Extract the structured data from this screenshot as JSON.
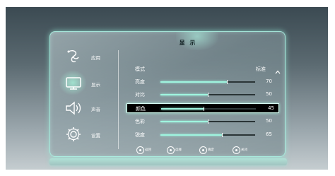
{
  "panel": {
    "title": "显 示"
  },
  "sidebar": {
    "items": [
      {
        "label": "应用",
        "icon": "app-swirl-icon",
        "active": false
      },
      {
        "label": "显示",
        "icon": "monitor-icon",
        "active": true
      },
      {
        "label": "声音",
        "icon": "speaker-icon",
        "active": false
      },
      {
        "label": "设置",
        "icon": "gear-icon",
        "active": false
      }
    ]
  },
  "mode": {
    "label": "模式",
    "value": "标准",
    "icon": "chevron-up-icon"
  },
  "settings": [
    {
      "label": "亮度",
      "value": "70",
      "level": 0.7,
      "selected": false
    },
    {
      "label": "对比",
      "value": "50",
      "level": 0.5,
      "selected": false
    },
    {
      "label": "颜色",
      "value": "45",
      "level": 0.45,
      "selected": true
    },
    {
      "label": "色彩",
      "value": "50",
      "level": 0.5,
      "selected": false
    },
    {
      "label": "锐度",
      "value": "65",
      "level": 0.65,
      "selected": false
    }
  ],
  "footer": [
    {
      "label": "返回",
      "icon": "back-ring-icon"
    },
    {
      "label": "选择",
      "icon": "select-ring-icon"
    },
    {
      "label": "确定",
      "icon": "confirm-ring-icon"
    },
    {
      "label": "关闭",
      "icon": "close-ring-icon"
    }
  ],
  "colors": {
    "accent": "#9ff5df",
    "selected_bg": "#000000"
  }
}
